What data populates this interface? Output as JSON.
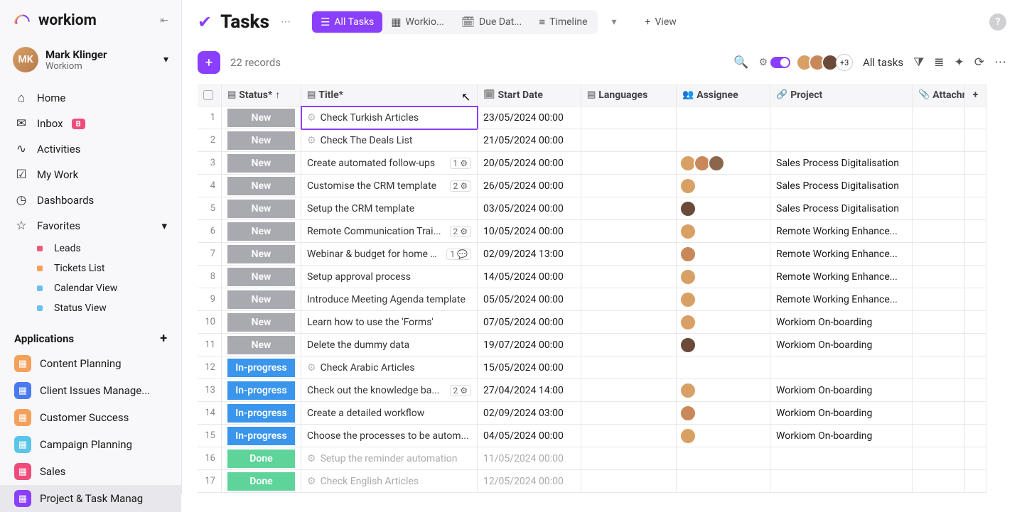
{
  "brand": "workiom",
  "user": {
    "name": "Mark Klinger",
    "org": "Workiom"
  },
  "nav": {
    "home": "Home",
    "inbox": "Inbox",
    "inbox_badge": "B",
    "activities": "Activities",
    "mywork": "My Work",
    "dashboards": "Dashboards",
    "favorites": "Favorites"
  },
  "favorites": [
    {
      "label": "Leads",
      "color": "#ef5a7a"
    },
    {
      "label": "Tickets List",
      "color": "#f5a05a"
    },
    {
      "label": "Calendar View",
      "color": "#6cc0f0"
    },
    {
      "label": "Status View",
      "color": "#6cc0f0"
    }
  ],
  "apps_header": "Applications",
  "apps": [
    {
      "label": "Content Planning",
      "color": "#f5a05a"
    },
    {
      "label": "Client Issues Manage...",
      "color": "#4a7af0"
    },
    {
      "label": "Customer Success",
      "color": "#f5a05a"
    },
    {
      "label": "Campaign Planning",
      "color": "#5ac5e8"
    },
    {
      "label": "Sales",
      "color": "#ef4c7c"
    },
    {
      "label": "Project & Task Manag",
      "color": "#8a3ffc"
    }
  ],
  "page": {
    "title": "Tasks"
  },
  "views": {
    "all": "All Tasks",
    "workio": "Workio...",
    "due": "Due Dat...",
    "timeline": "Timeline",
    "add": "View"
  },
  "toolbar": {
    "records": "22 records",
    "more": "+3",
    "alltasks": "All tasks"
  },
  "columns": {
    "status": "Status*",
    "title": "Title*",
    "start": "Start Date",
    "lang": "Languages",
    "assignee": "Assignee",
    "project": "Project",
    "attach": "Attachm"
  },
  "rows": [
    {
      "n": 1,
      "status": "New",
      "stc": "st-new",
      "title": "Check Turkish Articles",
      "auto": true,
      "start": "23/05/2024 00:00",
      "assignees": [],
      "project": "",
      "sel": true
    },
    {
      "n": 2,
      "status": "New",
      "stc": "st-new",
      "title": "Check The Deals List",
      "auto": true,
      "start": "21/05/2024 00:00",
      "assignees": [],
      "project": ""
    },
    {
      "n": 3,
      "status": "New",
      "stc": "st-new",
      "title": "Create automated follow-ups",
      "badge": "1",
      "bicon": "⚙",
      "start": "20/05/2024 00:00",
      "assignees": [
        "#d9a066",
        "#c9885a",
        "#8a664d"
      ],
      "project": "Sales Process Digitalisation"
    },
    {
      "n": 4,
      "status": "New",
      "stc": "st-new",
      "title": "Customise the CRM template",
      "badge": "2",
      "bicon": "⚙",
      "start": "26/05/2024 00:00",
      "assignees": [
        "#d9a066"
      ],
      "project": "Sales Process Digitalisation"
    },
    {
      "n": 5,
      "status": "New",
      "stc": "st-new",
      "title": "Setup the CRM template",
      "start": "03/05/2024 00:00",
      "assignees": [
        "#6b4a3a"
      ],
      "project": "Sales Process Digitalisation"
    },
    {
      "n": 6,
      "status": "New",
      "stc": "st-new",
      "title": "Remote Communication Trai...",
      "badge": "2",
      "bicon": "⚙",
      "start": "10/05/2024 00:00",
      "assignees": [
        "#d9a066"
      ],
      "project": "Remote Working Enhance..."
    },
    {
      "n": 7,
      "status": "New",
      "stc": "st-new",
      "title": "Webinar & budget for home o...",
      "badge": "1",
      "bicon": "💬",
      "start": "02/09/2024 13:00",
      "assignees": [
        "#c9885a"
      ],
      "project": "Remote Working Enhance..."
    },
    {
      "n": 8,
      "status": "New",
      "stc": "st-new",
      "title": "Setup approval process",
      "start": "14/05/2024 00:00",
      "assignees": [
        "#d9a066"
      ],
      "project": "Remote Working Enhance..."
    },
    {
      "n": 9,
      "status": "New",
      "stc": "st-new",
      "title": "Introduce Meeting Agenda template",
      "start": "05/05/2024 00:00",
      "assignees": [
        "#d9a066"
      ],
      "project": "Remote Working Enhance..."
    },
    {
      "n": 10,
      "status": "New",
      "stc": "st-new",
      "title": "Learn how to use the 'Forms'",
      "start": "07/05/2024 00:00",
      "assignees": [
        "#d9a066"
      ],
      "project": "Workiom On-boarding"
    },
    {
      "n": 11,
      "status": "New",
      "stc": "st-new",
      "title": "Delete the dummy data",
      "start": "19/07/2024 00:00",
      "assignees": [
        "#6b4a3a"
      ],
      "project": "Workiom On-boarding"
    },
    {
      "n": 12,
      "status": "In-progress",
      "stc": "st-prog",
      "title": "Check Arabic Articles",
      "auto": true,
      "start": "15/05/2024 00:00",
      "assignees": [],
      "project": ""
    },
    {
      "n": 13,
      "status": "In-progress",
      "stc": "st-prog",
      "title": "Check out the knowledge ba...",
      "badge": "2",
      "bicon": "⚙",
      "start": "27/04/2024 14:00",
      "assignees": [
        "#d9a066"
      ],
      "project": "Workiom On-boarding"
    },
    {
      "n": 14,
      "status": "In-progress",
      "stc": "st-prog",
      "title": "Create a detailed workflow",
      "start": "02/09/2024 03:00",
      "assignees": [
        "#c9885a"
      ],
      "project": "Workiom On-boarding"
    },
    {
      "n": 15,
      "status": "In-progress",
      "stc": "st-prog",
      "title": "Choose the processes to be autom...",
      "start": "04/05/2024 00:00",
      "assignees": [
        "#d9a066"
      ],
      "project": "Workiom On-boarding"
    },
    {
      "n": 16,
      "status": "Done",
      "stc": "st-done",
      "title": "Setup the reminder automation",
      "auto": true,
      "dim": true,
      "start": "11/05/2024 00:00",
      "assignees": [],
      "project": ""
    },
    {
      "n": 17,
      "status": "Done",
      "stc": "st-done",
      "title": "Check English Articles",
      "auto": true,
      "dim": true,
      "start": "12/05/2024 00:00",
      "assignees": [],
      "project": ""
    }
  ]
}
